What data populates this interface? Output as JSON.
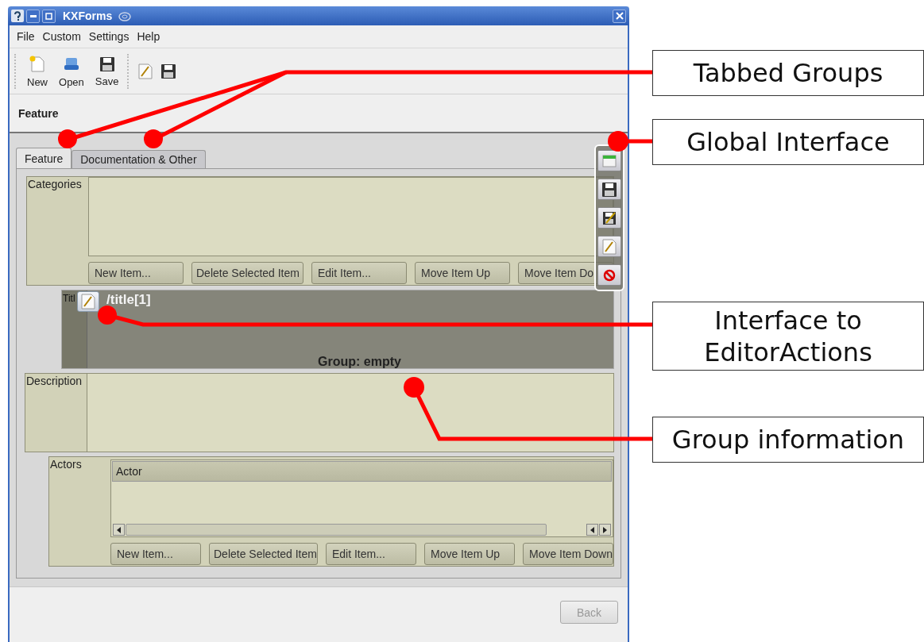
{
  "window": {
    "title": "KXForms"
  },
  "menu": [
    "File",
    "Custom",
    "Settings",
    "Help"
  ],
  "toolbar": [
    {
      "kind": "new",
      "label": "New"
    },
    {
      "kind": "open",
      "label": "Open"
    },
    {
      "kind": "save",
      "label": "Save"
    },
    {
      "kind": "edit"
    },
    {
      "kind": "save"
    }
  ],
  "header": "Feature",
  "tabs": [
    {
      "label": "Feature",
      "selected": true
    },
    {
      "label": "Documentation & Other",
      "selected": false
    }
  ],
  "groups": [
    {
      "kind": "list",
      "label": "Categories",
      "buttons": [
        "New Item...",
        "Delete Selected Item",
        "Edit Item...",
        "Move Item Up",
        "Move Item Do"
      ]
    },
    {
      "kind": "active",
      "label": "Titl",
      "path": "/title[1]",
      "info": "Group: empty"
    },
    {
      "kind": "text",
      "label": "Description"
    },
    {
      "kind": "table",
      "label": "Actors",
      "column": "Actor",
      "buttons": [
        "New Item...",
        "Delete Selected Item",
        "Edit Item...",
        "Move Item Up",
        "Move Item Down"
      ]
    }
  ],
  "global_actions": [
    {
      "kind": "table"
    },
    {
      "kind": "save"
    },
    {
      "kind": "save-edit"
    },
    {
      "kind": "edit"
    },
    {
      "kind": "cancel"
    }
  ],
  "back_button": {
    "label": "Back",
    "disabled": true
  },
  "callouts": [
    {
      "text": "Tabbed Groups"
    },
    {
      "text": "Global Interface"
    },
    {
      "text": "Interface to EditorActions"
    },
    {
      "text": "Group information"
    }
  ]
}
